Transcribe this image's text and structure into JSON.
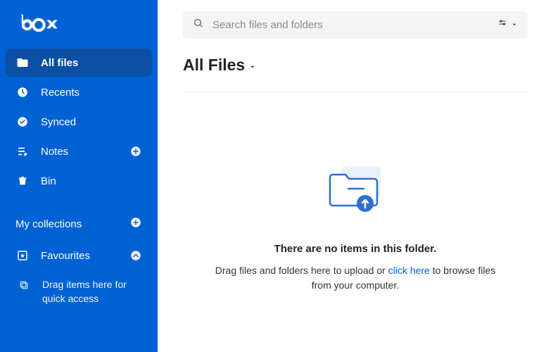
{
  "brand": {
    "name": "box"
  },
  "search": {
    "placeholder": "Search files and folders"
  },
  "sidebar": {
    "items": [
      {
        "label": "All files"
      },
      {
        "label": "Recents"
      },
      {
        "label": "Synced"
      },
      {
        "label": "Notes"
      },
      {
        "label": "Bin"
      }
    ],
    "collections_label": "My collections",
    "favourites_label": "Favourites",
    "drag_hint": "Drag items here for quick access"
  },
  "page": {
    "title": "All Files"
  },
  "empty": {
    "headline": "There are no items in this folder.",
    "pre": "Drag files and folders here to upload or ",
    "link": "click here",
    "post": " to browse files from your computer."
  }
}
